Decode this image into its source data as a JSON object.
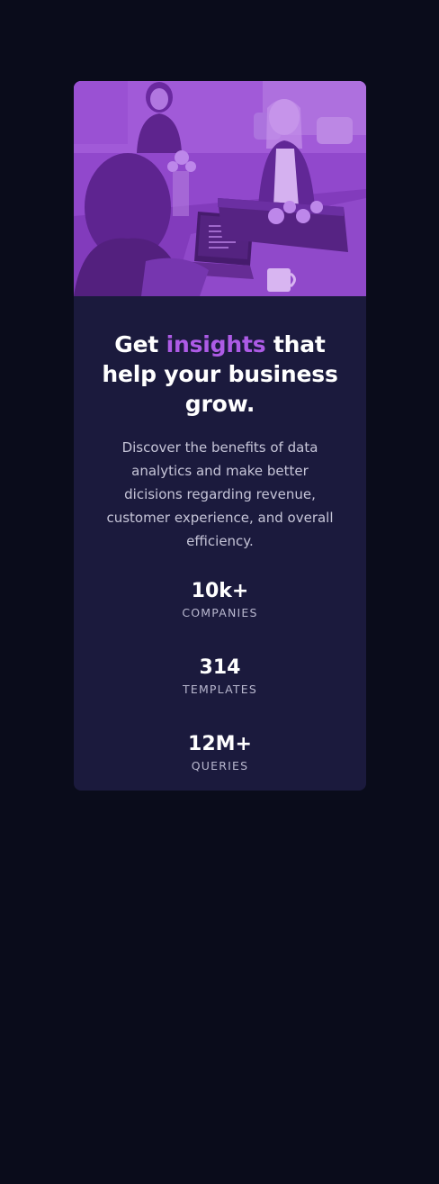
{
  "page": {
    "background_color": "#0a0c1b"
  },
  "card": {
    "background_color": "#1b1a3d",
    "image": {
      "description_icon": "office-team-photo",
      "tint_color": "#9a4fd6"
    },
    "title": {
      "prefix": "Get",
      "highlight": "insights",
      "suffix": "that help your business grow.",
      "highlight_color": "#ad5be6"
    },
    "description": "Discover the benefits of data analytics and make better dicisions regarding revenue, customer experience, and overall efficiency.",
    "stats": [
      {
        "value": "10k+",
        "label": "COMPANIES"
      },
      {
        "value": "314",
        "label": "TEMPLATES"
      },
      {
        "value": "12M+",
        "label": "QUERIES"
      }
    ]
  }
}
